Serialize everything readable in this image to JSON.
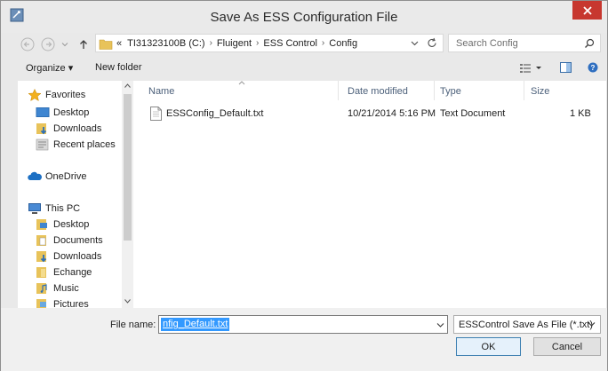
{
  "window": {
    "title": "Save As ESS Configuration File"
  },
  "address": {
    "overflow": "«",
    "crumbs": [
      "TI31323100B (C:)",
      "Fluigent",
      "ESS Control",
      "Config"
    ]
  },
  "search": {
    "placeholder": "Search Config"
  },
  "toolbar": {
    "organize": "Organize ▾",
    "new_folder": "New folder"
  },
  "navpane": {
    "favorites": "Favorites",
    "fav_items": [
      "Desktop",
      "Downloads",
      "Recent places"
    ],
    "onedrive": "OneDrive",
    "thispc": "This PC",
    "pc_items": [
      "Desktop",
      "Documents",
      "Downloads",
      "Echange",
      "Music",
      "Pictures"
    ]
  },
  "columns": {
    "name": "Name",
    "date": "Date modified",
    "type": "Type",
    "size": "Size"
  },
  "files": [
    {
      "name": "ESSConfig_Default.txt",
      "date": "10/21/2014 5:16 PM",
      "type": "Text Document",
      "size": "1 KB"
    }
  ],
  "filename": {
    "label": "File name:",
    "value": "nfig_Default.txt"
  },
  "filetype": {
    "value": "ESSControl Save As File (*.txt)"
  },
  "buttons": {
    "ok": "OK",
    "cancel": "Cancel"
  },
  "colors": {
    "close": "#c7372f",
    "selection": "#3399ff",
    "folder": "#e8c35a",
    "header_text": "#4c607a"
  }
}
